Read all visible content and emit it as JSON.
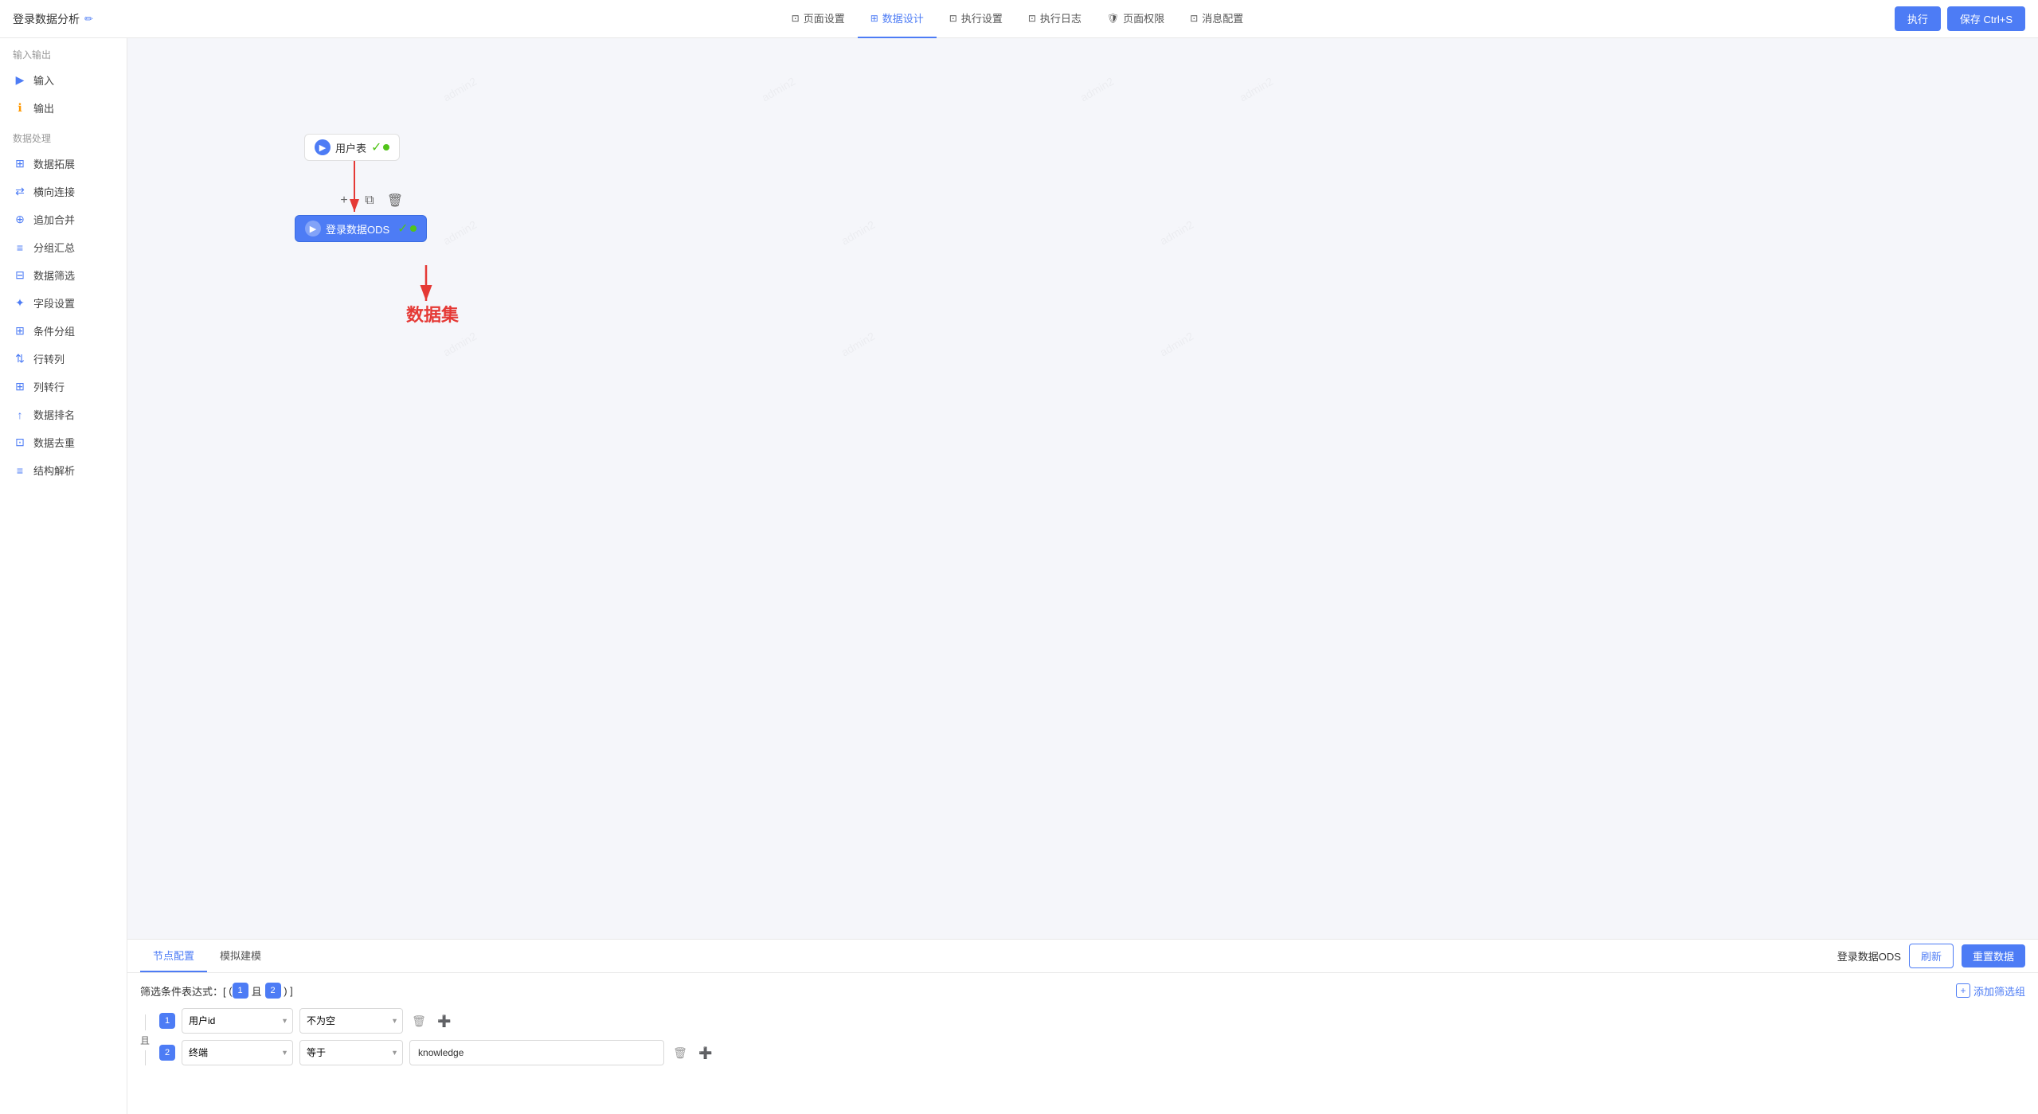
{
  "header": {
    "title": "登录数据分析",
    "edit_icon": "✏",
    "nav_items": [
      {
        "id": "page-settings",
        "label": "页面设置",
        "icon": "⊡",
        "active": false
      },
      {
        "id": "data-design",
        "label": "数据设计",
        "icon": "⊞",
        "active": true
      },
      {
        "id": "exec-settings",
        "label": "执行设置",
        "icon": "⊡",
        "active": false
      },
      {
        "id": "exec-log",
        "label": "执行日志",
        "icon": "⊡",
        "active": false
      },
      {
        "id": "page-auth",
        "label": "页面权限",
        "icon": "🛡",
        "active": false
      },
      {
        "id": "msg-config",
        "label": "消息配置",
        "icon": "⊡",
        "active": false
      }
    ],
    "btn_execute": "执行",
    "btn_save": "保存 Ctrl+S"
  },
  "sidebar": {
    "section_io": "输入输出",
    "section_processing": "数据处理",
    "io_items": [
      {
        "id": "input",
        "label": "输入",
        "icon": "▶"
      },
      {
        "id": "output",
        "label": "输出",
        "icon": "ℹ"
      }
    ],
    "processing_items": [
      {
        "id": "data-expand",
        "label": "数据拓展",
        "icon": "⊞"
      },
      {
        "id": "horizontal-join",
        "label": "横向连接",
        "icon": "⇄"
      },
      {
        "id": "append-merge",
        "label": "追加合并",
        "icon": "⊕"
      },
      {
        "id": "group-summary",
        "label": "分组汇总",
        "icon": "≡"
      },
      {
        "id": "data-filter",
        "label": "数据筛选",
        "icon": "⊟"
      },
      {
        "id": "field-settings",
        "label": "字段设置",
        "icon": "✦"
      },
      {
        "id": "cond-split",
        "label": "条件分组",
        "icon": "⊞"
      },
      {
        "id": "row-to-col",
        "label": "行转列",
        "icon": "⇅"
      },
      {
        "id": "col-to-row",
        "label": "列转行",
        "icon": "⊞"
      },
      {
        "id": "data-ranking",
        "label": "数据排名",
        "icon": "↑"
      },
      {
        "id": "data-dedup",
        "label": "数据去重",
        "icon": "⊡"
      },
      {
        "id": "struct-parse",
        "label": "结构解析",
        "icon": "≡"
      }
    ]
  },
  "canvas": {
    "node_user_table": {
      "label": "用户表",
      "icon": "▶"
    },
    "node_ods": {
      "label": "登录数据ODS",
      "icon": "▶"
    },
    "annotation_label": "数据集",
    "toolbar": {
      "add": "+",
      "copy": "⧉",
      "delete": "🗑"
    }
  },
  "bottom_panel": {
    "tab_node_config": "节点配置",
    "tab_mock": "模拟建模",
    "node_name": "登录数据ODS",
    "btn_refresh": "刷新",
    "btn_reset": "重置数据",
    "filter_expr_label": "筛选条件表达式：[",
    "filter_expr_open": "(",
    "filter_expr_and": "且",
    "filter_expr_close": ")",
    "filter_expr_end": "]",
    "add_filter_label": "添加筛选组",
    "filter_rows": [
      {
        "number": "1",
        "field": "用户id",
        "operator": "不为空",
        "value": ""
      },
      {
        "number": "2",
        "field": "终端",
        "operator": "等于",
        "value": "knowledge"
      }
    ],
    "and_connector": "且"
  },
  "watermarks": [
    "admin2",
    "admin2",
    "admin2",
    "admin2",
    "admin2",
    "admin2"
  ]
}
